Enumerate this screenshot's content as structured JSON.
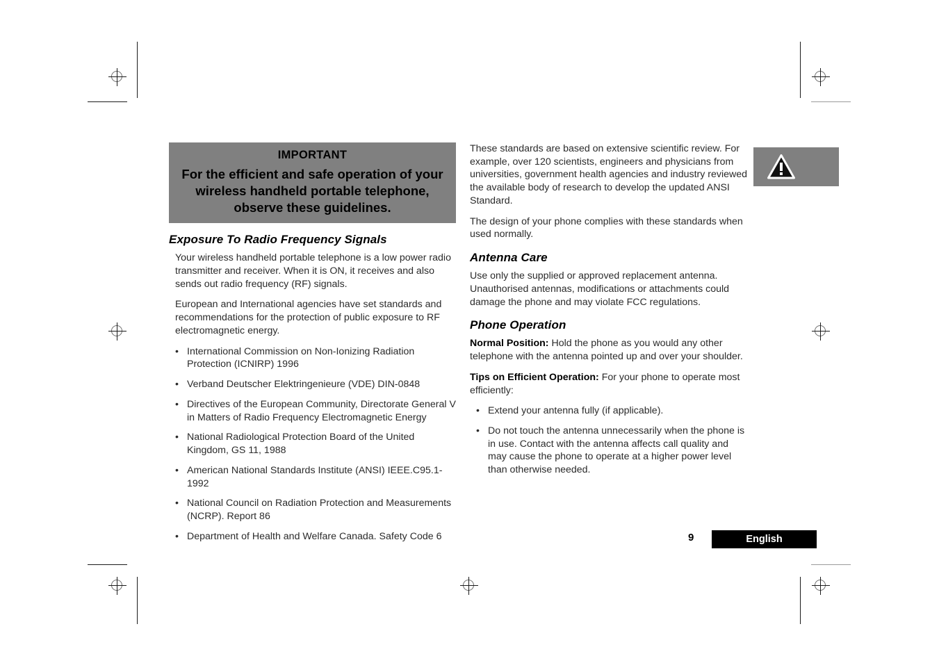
{
  "page": {
    "number": "9",
    "language_label": "English"
  },
  "important_box": {
    "title": "IMPORTANT",
    "body": "For the efficient and safe operation of your wireless handheld portable telephone, observe these guidelines."
  },
  "warning_icon": {
    "name": "warning-triangle-icon"
  },
  "left_column": {
    "heading": "Exposure To Radio Frequency Signals",
    "paragraphs": [
      "Your wireless handheld portable telephone is a low power radio transmitter and receiver. When it is ON, it receives and also sends out radio frequency (RF) signals.",
      "European and International agencies have set standards and recommendations for the protection of public exposure to RF electromagnetic energy."
    ],
    "bullets": [
      "International Commission on Non-Ionizing Radiation Protection (ICNIRP) 1996",
      "Verband Deutscher Elektringenieure (VDE) DIN-0848",
      "Directives of the European Community, Directorate General V in Matters of Radio Frequency Electromagnetic Energy",
      "National Radiological Protection Board of the United Kingdom, GS 11, 1988",
      "American National Standards Institute (ANSI) IEEE.C95.1-1992",
      "National Council on Radiation Protection and Measurements (NCRP). Report 86",
      "Department of Health and Welfare Canada. Safety Code 6"
    ],
    "bullet_glyph": "•"
  },
  "right_column": {
    "intro_paragraphs": [
      "These standards are based on extensive scientific review. For example, over 120 scientists, engineers and physicians from universities, government health agencies and industry reviewed the available body of research to develop the updated ANSI Standard.",
      "The design of your phone complies with these standards when used normally."
    ],
    "antenna_care": {
      "heading": "Antenna Care",
      "body": "Use only the supplied or approved replacement antenna. Unauthorised antennas, modifications or attachments could damage the phone and may violate FCC regulations."
    },
    "phone_operation": {
      "heading": "Phone Operation",
      "normal_position_label": "Normal Position:",
      "normal_position_text": " Hold the phone as you would any other telephone with the antenna pointed up and over your shoulder.",
      "tips_label": "Tips on Efficient Operation:",
      "tips_text": " For your phone to operate most efficiently:",
      "bullets": [
        "Extend your antenna fully (if applicable).",
        "Do not touch the antenna unnecessarily when the phone is in use. Contact with the antenna affects call quality and may cause the phone to operate at a higher power level than otherwise needed."
      ]
    }
  }
}
